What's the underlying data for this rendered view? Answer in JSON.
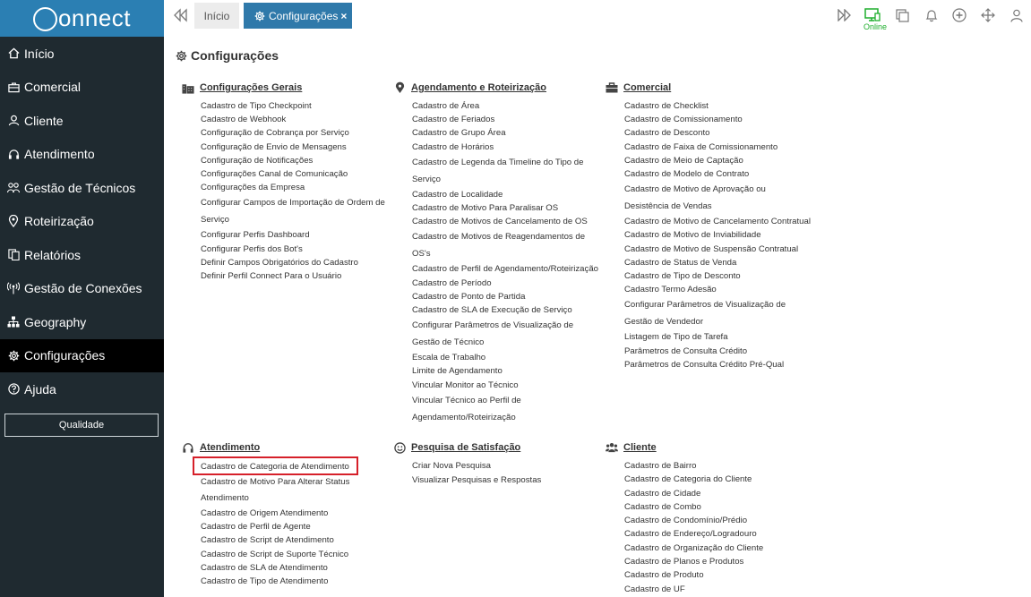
{
  "app": {
    "logo_text": "onnect",
    "brand_color": "#2b7fb3"
  },
  "sidebar": {
    "items": [
      {
        "label": "Início",
        "icon": "home-icon"
      },
      {
        "label": "Comercial",
        "icon": "briefcase-icon"
      },
      {
        "label": "Cliente",
        "icon": "user-icon"
      },
      {
        "label": "Atendimento",
        "icon": "headset-icon"
      },
      {
        "label": "Gestão de Técnicos",
        "icon": "technicians-icon"
      },
      {
        "label": "Roteirização",
        "icon": "map-marker-icon"
      },
      {
        "label": "Relatórios",
        "icon": "reports-icon"
      },
      {
        "label": "Gestão de Conexões",
        "icon": "antenna-icon"
      },
      {
        "label": "Geography",
        "icon": "sitemap-icon"
      },
      {
        "label": "Configurações",
        "icon": "gear-icon",
        "active": true
      },
      {
        "label": "Ajuda",
        "icon": "help-icon"
      }
    ],
    "quality_button": "Qualidade"
  },
  "topbar": {
    "tab_home": "Início",
    "tab_active": "Configurações",
    "tab_close": "×",
    "online_label": "Online",
    "online_color": "#1fae2d"
  },
  "page": {
    "title": "Configurações"
  },
  "sections": {
    "gerais": {
      "title": "Configurações Gerais",
      "links": [
        "Cadastro de Tipo Checkpoint",
        "Cadastro de Webhook",
        "Configuração de Cobrança por Serviço",
        "Configuração de Envio de Mensagens",
        "Configuração de Notificações",
        "Configurações Canal de Comunicação",
        "Configurações da Empresa",
        "Configurar Campos de Importação de Ordem de",
        "Serviço",
        "Configurar Perfis Dashboard",
        "Configurar Perfis dos Bot's",
        "Definir Campos Obrigatórios do Cadastro",
        "Definir Perfil Connect Para o Usuário"
      ]
    },
    "agendamento": {
      "title": "Agendamento e Roteirização",
      "links": [
        "Cadastro de Área",
        "Cadastro de Feriados",
        "Cadastro de Grupo Área",
        "Cadastro de Horários",
        "Cadastro de Legenda da Timeline do Tipo de",
        "Serviço",
        "Cadastro de Localidade",
        "Cadastro de Motivo Para Paralisar OS",
        "Cadastro de Motivos de Cancelamento de OS",
        "Cadastro de Motivos de Reagendamentos de",
        "OS's",
        "Cadastro de Perfil de Agendamento/Roteirização",
        "Cadastro de Período",
        "Cadastro de Ponto de Partida",
        "Cadastro de SLA de Execução de Serviço",
        "Configurar Parâmetros de Visualização de",
        "Gestão de Técnico",
        "Escala de Trabalho",
        "Limite de Agendamento",
        "Vincular Monitor ao Técnico",
        "Vincular Técnico ao Perfil de",
        "Agendamento/Roteirização"
      ]
    },
    "comercial": {
      "title": "Comercial",
      "links": [
        "Cadastro de Checklist",
        "Cadastro de Comissionamento",
        "Cadastro de Desconto",
        "Cadastro de Faixa de Comissionamento",
        "Cadastro de Meio de Captação",
        "Cadastro de Modelo de Contrato",
        "Cadastro de Motivo de Aprovação ou",
        "Desistência de Vendas",
        "Cadastro de Motivo de Cancelamento Contratual",
        "Cadastro de Motivo de Inviabilidade",
        "Cadastro de Motivo de Suspensão Contratual",
        "Cadastro de Status de Venda",
        "Cadastro de Tipo de Desconto",
        "Cadastro Termo Adesão",
        "Configurar Parâmetros de Visualização de",
        "Gestão de Vendedor",
        "Listagem de Tipo de Tarefa",
        "Parâmetros de Consulta Crédito",
        "Parâmetros de Consulta Crédito Pré-Qual"
      ]
    },
    "atendimento": {
      "title": "Atendimento",
      "links": [
        "Cadastro de Categoria de Atendimento",
        "Cadastro de Motivo Para Alterar Status",
        "Atendimento",
        "Cadastro de Origem Atendimento",
        "Cadastro de Perfil de Agente",
        "Cadastro de Script de Atendimento",
        "Cadastro de Script de Suporte Técnico",
        "Cadastro de SLA de Atendimento",
        "Cadastro de Tipo de Atendimento"
      ]
    },
    "pesquisa": {
      "title": "Pesquisa de Satisfação",
      "links": [
        "Criar Nova Pesquisa",
        "Visualizar Pesquisas e Respostas"
      ]
    },
    "cliente": {
      "title": "Cliente",
      "links": [
        "Cadastro de Bairro",
        "Cadastro de Categoria do Cliente",
        "Cadastro de Cidade",
        "Cadastro de Combo",
        "Cadastro de Condomínio/Prédio",
        "Cadastro de Endereço/Logradouro",
        "Cadastro de Organização do Cliente",
        "Cadastro de Planos e Produtos",
        "Cadastro de Produto",
        "Cadastro de UF"
      ]
    }
  }
}
